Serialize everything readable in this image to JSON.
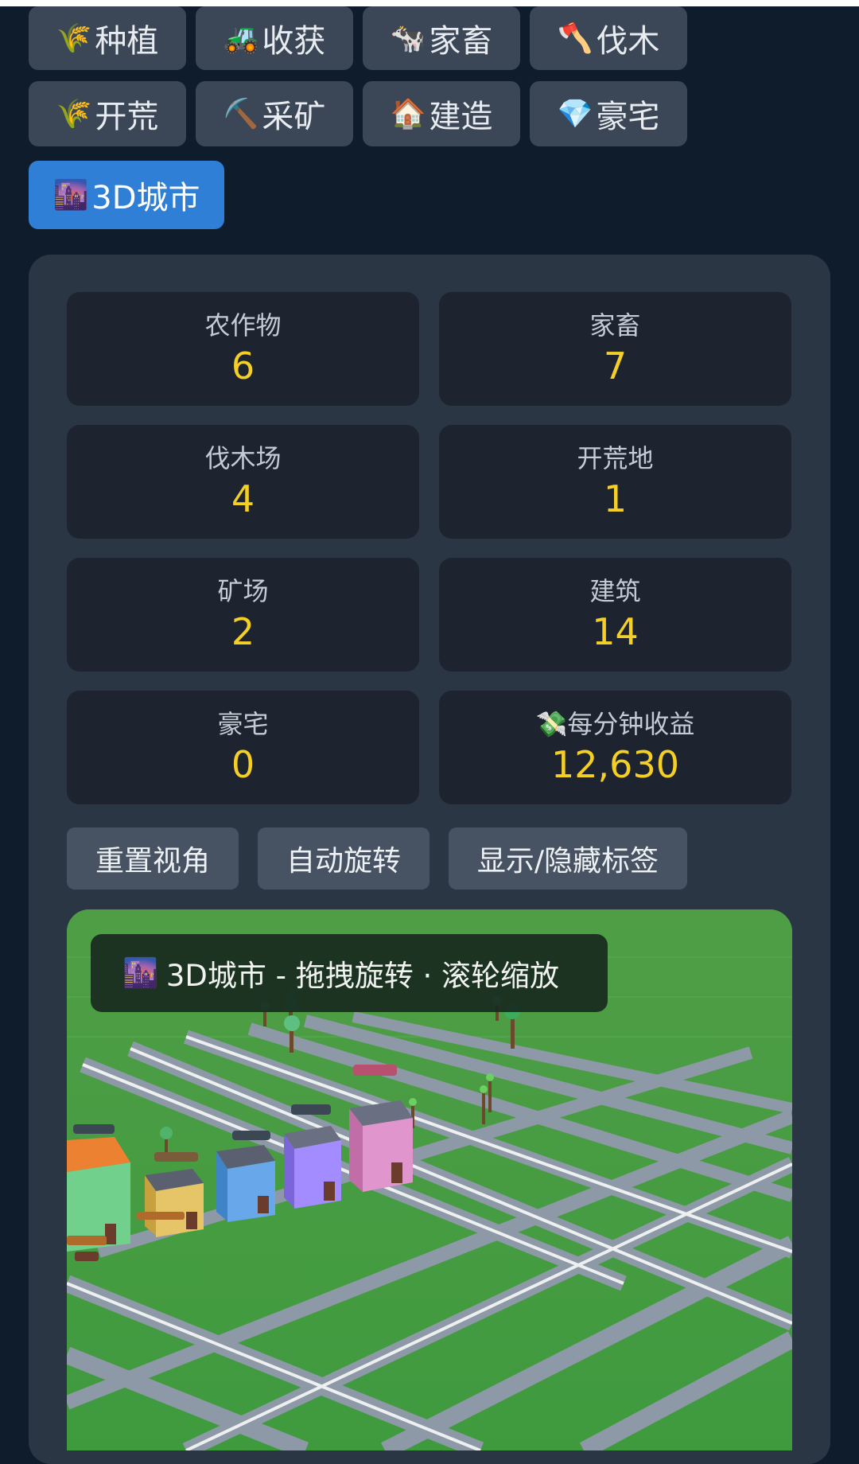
{
  "tabs": [
    {
      "icon": "🌾",
      "icon_name": "wheat-icon",
      "label": "种植",
      "active": false
    },
    {
      "icon": "🚜",
      "icon_name": "tractor-icon",
      "label": "收获",
      "active": false
    },
    {
      "icon": "🐄",
      "icon_name": "cow-icon",
      "label": "家畜",
      "active": false
    },
    {
      "icon": "🪓",
      "icon_name": "axe-icon",
      "label": "伐木",
      "active": false
    },
    {
      "icon": "🌾",
      "icon_name": "wheat-icon",
      "label": "开荒",
      "active": false
    },
    {
      "icon": "⛏️",
      "icon_name": "pickaxe-icon",
      "label": "采矿",
      "active": false
    },
    {
      "icon": "🏠",
      "icon_name": "house-icon",
      "label": "建造",
      "active": false
    },
    {
      "icon": "💎",
      "icon_name": "gem-icon",
      "label": "豪宅",
      "active": false
    },
    {
      "icon": "🌆",
      "icon_name": "city-icon",
      "label": "3D城市",
      "active": true
    }
  ],
  "stats": [
    {
      "label": "农作物",
      "value": "6"
    },
    {
      "label": "家畜",
      "value": "7"
    },
    {
      "label": "伐木场",
      "value": "4"
    },
    {
      "label": "开荒地",
      "value": "1"
    },
    {
      "label": "矿场",
      "value": "2"
    },
    {
      "label": "建筑",
      "value": "14"
    },
    {
      "label": "豪宅",
      "value": "0"
    },
    {
      "label": "每分钟收益",
      "value": "12,630",
      "icon": "💸",
      "icon_name": "money-icon"
    }
  ],
  "controls": {
    "reset_view": "重置视角",
    "auto_rotate": "自动旋转",
    "toggle_labels": "显示/隐藏标签"
  },
  "scene": {
    "overlay_icon": "🌆",
    "overlay_text": "3D城市 - 拖拽旋转 · 滚轮缩放"
  },
  "colors": {
    "background": "#0e1c2b",
    "panel": "#2b3645",
    "card": "#1d2430",
    "value": "#f4cf25",
    "active_tab": "#2f7fd6",
    "tab": "#3b4756",
    "grass": "#3d9a3c"
  }
}
